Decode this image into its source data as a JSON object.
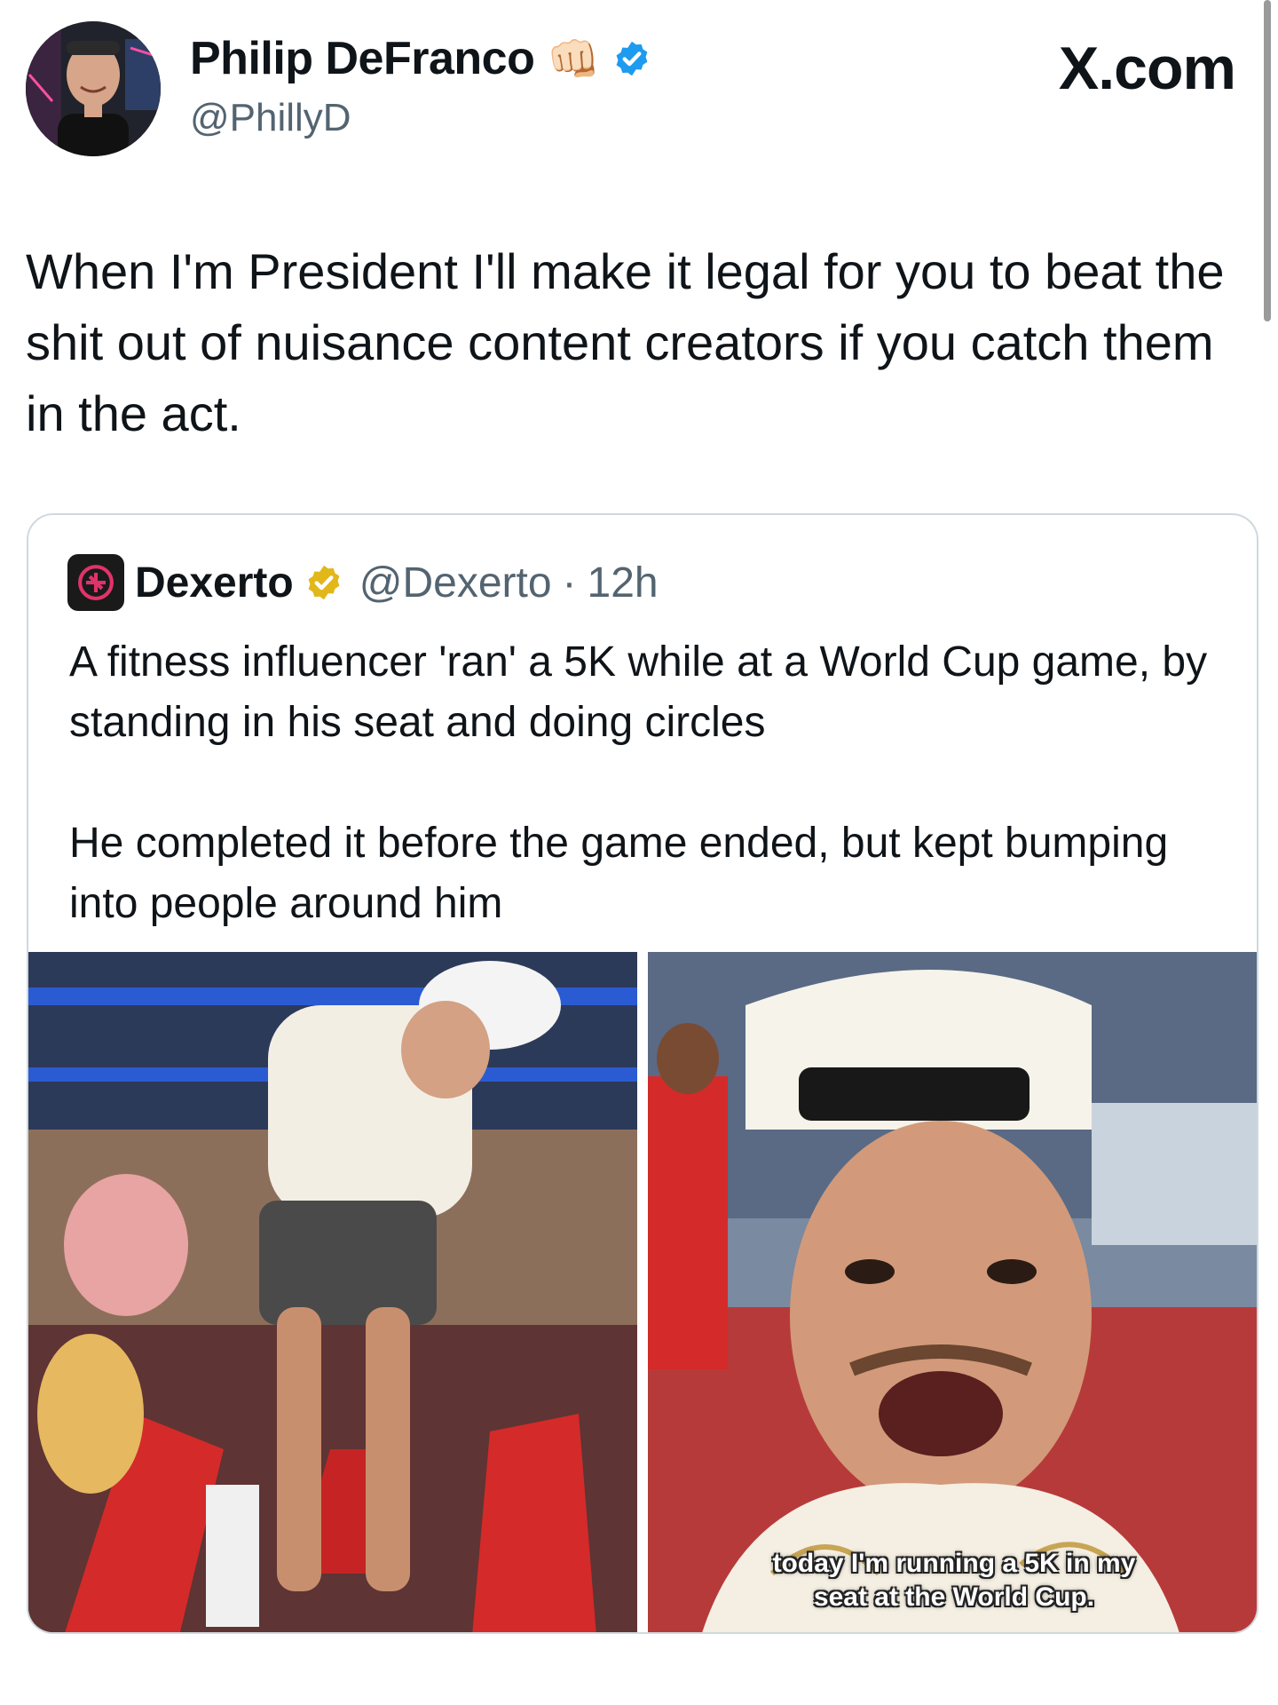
{
  "author": {
    "name": "Philip DeFranco",
    "handle": "@PhillyD",
    "fist_emoji": "👊🏻",
    "verified": true
  },
  "brand": "X.com",
  "tweet": {
    "text": "When I'm President I'll make it legal for you to beat the shit out of nuisance content creators if you catch them in the act."
  },
  "quote": {
    "name": "Dexerto",
    "handle": "@Dexerto",
    "separator": "·",
    "time": "12h",
    "text": "A fitness influencer 'ran' a 5K while at a World Cup game, by standing  in his seat and doing circles\n\nHe completed it before the game ended, but kept bumping into people around him",
    "video_caption": "today I'm running a 5K in my\nseat at the World Cup."
  },
  "colors": {
    "verified_blue": "#1d9bf0",
    "verified_gold": "#e2b719",
    "text": "#0f1419",
    "muted": "#536471",
    "border": "#cfd9de",
    "stadium_red": "#d42a2a"
  },
  "icons": {
    "verified_badge": "blue-check-icon",
    "org_badge": "gold-check-icon",
    "logo": "dexerto-logo"
  }
}
